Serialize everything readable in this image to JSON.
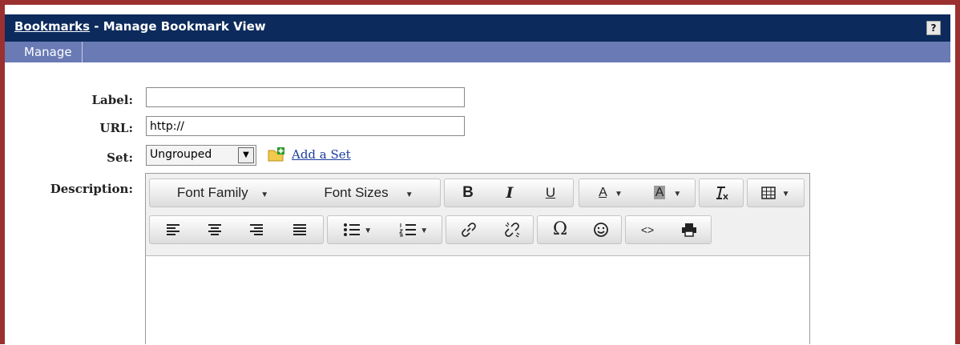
{
  "header": {
    "bookmarks_link": "Bookmarks",
    "title_rest": " - Manage Bookmark View",
    "help": "?"
  },
  "tabs": [
    {
      "label": "Manage"
    }
  ],
  "form": {
    "label_label": "Label:",
    "label_value": "",
    "url_label": "URL:",
    "url_value": "http://",
    "set_label": "Set:",
    "set_value": "Ungrouped",
    "add_set": "Add a Set",
    "description_label": "Description:"
  },
  "editor": {
    "font_family": "Font Family",
    "font_sizes": "Font Sizes",
    "bold": "B",
    "italic": "I",
    "underline": "U",
    "text_color": "A",
    "bg_color": "A",
    "symbol": "Ω",
    "code": "<>"
  },
  "colors": {
    "frame": "#9b3030",
    "titlebar": "#0c2a5c",
    "tabbar": "#6a7ab5",
    "link": "#1a3d9e"
  }
}
